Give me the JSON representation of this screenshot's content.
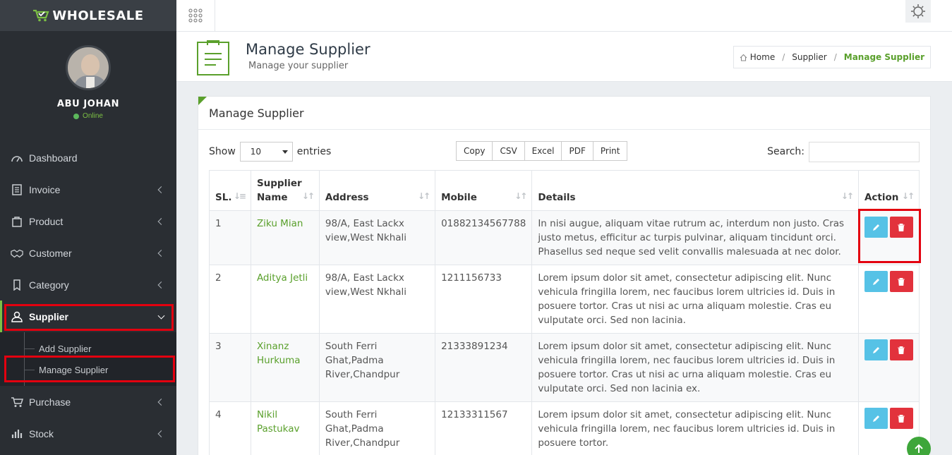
{
  "app": {
    "logo_text": "WHOLESALE"
  },
  "user": {
    "name": "ABU JOHAN",
    "status": "Online"
  },
  "sidebar": {
    "items": [
      {
        "label": "Dashboard",
        "icon": "dashboard-icon"
      },
      {
        "label": "Invoice",
        "icon": "invoice-icon"
      },
      {
        "label": "Product",
        "icon": "product-icon"
      },
      {
        "label": "Customer",
        "icon": "handshake-icon"
      },
      {
        "label": "Category",
        "icon": "category-icon"
      },
      {
        "label": "Supplier",
        "icon": "user-icon"
      },
      {
        "label": "Purchase",
        "icon": "cart-icon"
      },
      {
        "label": "Stock",
        "icon": "bar-chart-icon"
      }
    ],
    "submenu": [
      {
        "label": "Add Supplier"
      },
      {
        "label": "Manage Supplier"
      }
    ]
  },
  "header": {
    "title": "Manage Supplier",
    "subtitle": "Manage your supplier",
    "breadcrumb": {
      "home": "Home",
      "section": "Supplier",
      "current": "Manage Supplier"
    }
  },
  "panel": {
    "title": "Manage Supplier",
    "show_label": "Show",
    "entries_value": "10",
    "entries_label": "entries",
    "export_buttons": [
      "Copy",
      "CSV",
      "Excel",
      "PDF",
      "Print"
    ],
    "search_label": "Search:"
  },
  "table": {
    "columns": [
      "SL.",
      "Supplier Name",
      "Address",
      "Mobile",
      "Details",
      "Action"
    ],
    "rows": [
      {
        "sl": "1",
        "name": "Ziku Mian",
        "address": "98/A, East Lackx view,West Nkhali",
        "mobile": "01882134567788",
        "details": "In nisi augue, aliquam vitae rutrum ac, interdum non justo. Cras justo metus, efficitur ac turpis pulvinar, aliquam tincidunt orci. Phasellus sed neque sed velit convallis malesuada at nec dolor."
      },
      {
        "sl": "2",
        "name": "Aditya Jetli",
        "address": "98/A, East Lackx view,West Nkhali",
        "mobile": "1211156733",
        "details": "Lorem ipsum dolor sit amet, consectetur adipiscing elit. Nunc vehicula fringilla lorem, nec faucibus lorem ultricies id. Duis in posuere tortor. Cras ut nisi ac urna aliquam molestie. Cras eu vulputate orci. Sed non lacinia."
      },
      {
        "sl": "3",
        "name": "Xinanz Hurkuma",
        "address": "South Ferri Ghat,Padma River,Chandpur",
        "mobile": "21333891234",
        "details": "Lorem ipsum dolor sit amet, consectetur adipiscing elit. Nunc vehicula fringilla lorem, nec faucibus lorem ultricies id. Duis in posuere tortor. Cras ut nisi ac urna aliquam molestie. Cras eu vulputate orci. Sed non lacinia ex."
      },
      {
        "sl": "4",
        "name": "Nikil Pastukav",
        "address": "South Ferri Ghat,Padma River,Chandpur",
        "mobile": "12133311567",
        "details": "Lorem ipsum dolor sit amet, consectetur adipiscing elit. Nunc vehicula fringilla lorem, nec faucibus lorem ultricies id. Duis in posuere tortor."
      }
    ]
  },
  "colors": {
    "accent": "#5aa02c",
    "sidebar_bg": "#2a2e33",
    "edit": "#56c2e6",
    "delete": "#e2323c",
    "highlight": "#e3000f"
  }
}
